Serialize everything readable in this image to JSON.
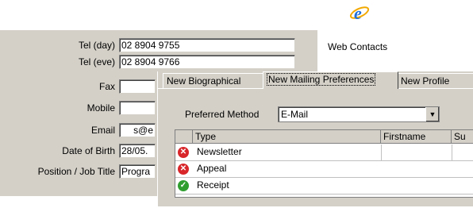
{
  "desktop": {
    "icon_label": "Web Contacts"
  },
  "form": {
    "fields": [
      {
        "label": "Tel (day)",
        "value": "02 8904 9755"
      },
      {
        "label": "Tel (eve)",
        "value": "02 8904 9766"
      },
      {
        "label": "Fax",
        "value": ""
      },
      {
        "label": "Mobile",
        "value": ""
      },
      {
        "label": "Email",
        "value": "s@e"
      },
      {
        "label": "Date of Birth",
        "value": "28/05."
      },
      {
        "label": "Position / Job Title",
        "value": "Progra"
      }
    ]
  },
  "dialog": {
    "tabs": [
      {
        "label": "New Biographical"
      },
      {
        "label": "New Mailing Preferences"
      },
      {
        "label": "New Profile"
      }
    ],
    "preferred_method_label": "Preferred Method",
    "preferred_method_value": "E-Mail",
    "grid": {
      "columns": [
        "Type",
        "Firstname",
        "Su"
      ],
      "rows": [
        {
          "status": "red",
          "type": "Newsletter"
        },
        {
          "status": "red",
          "type": "Appeal"
        },
        {
          "status": "green",
          "type": "Receipt"
        }
      ]
    }
  },
  "colors": {
    "panel": "#d4d0c8",
    "status_red": "#d8262a",
    "status_green": "#2f9e2f",
    "ie_blue": "#1e6fd9",
    "ie_orange": "#f2a900"
  },
  "icons": {
    "desktop_icon": "internet-explorer-icon",
    "dropdown": "dropdown-arrow-icon",
    "row_red": "x-circle-icon",
    "row_green": "check-circle-icon"
  }
}
